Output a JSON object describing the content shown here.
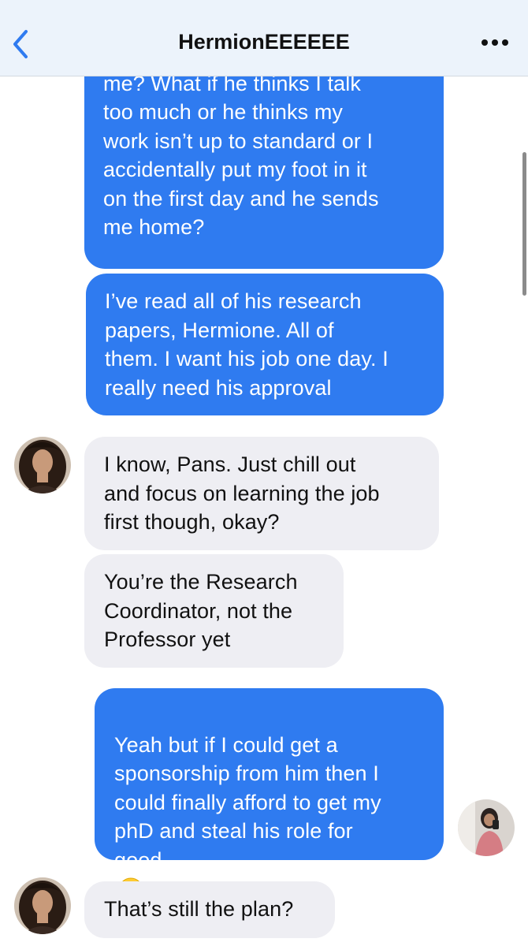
{
  "header": {
    "title": "HermionEEEEEE",
    "back_icon": "chevron-left-icon",
    "more_icon": "ellipsis-icon"
  },
  "colors": {
    "outgoing_bubble": "#2f7bf0",
    "incoming_bubble": "#eeeef3",
    "header_background": "#ecf3fb",
    "accent": "#2f7bf0"
  },
  "messages": [
    {
      "sender": "me",
      "text": "the Professor doesn’t like\nme? What if he thinks I talk\ntoo much or he thinks my\nwork isn’t up to standard or I\naccidentally put my foot in it\non the first day and he sends\nme home?"
    },
    {
      "sender": "me",
      "text": "I’ve read all of his research\npapers, Hermione. All of\nthem. I want his job one day. I\nreally need his approval"
    },
    {
      "sender": "them",
      "text": "I know, Pans. Just chill out\nand focus on learning the job\nfirst though, okay?"
    },
    {
      "sender": "them",
      "text": "You’re the Research\nCoordinator, not the\nProfessor yet"
    },
    {
      "sender": "me",
      "text": "Yeah but if I could get a\nsponsorship from him then I\ncould finally afford to get my\nphD and steal his role for\ngood",
      "emoji": "winking-face-with-tongue"
    },
    {
      "sender": "them",
      "text": "That’s still the plan?"
    }
  ]
}
